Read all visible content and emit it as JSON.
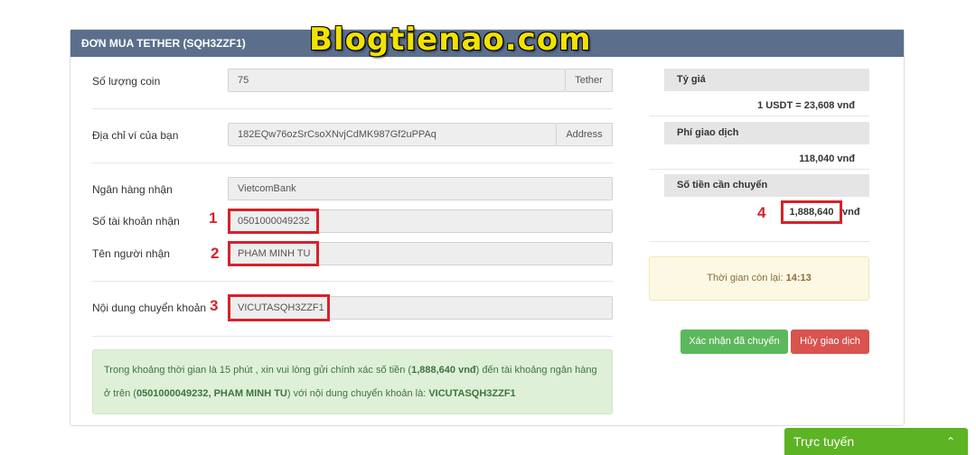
{
  "panel": {
    "title": "ĐƠN MUA TETHER (SQH3ZZF1)"
  },
  "watermark": "Blogtienao.com",
  "form": {
    "coin_label": "Số lượng coin",
    "coin_value": "75",
    "coin_unit": "Tether",
    "wallet_label": "Địa chỉ ví của bạn",
    "wallet_value": "182EQw76ozSrCsoXNvjCdMK987Gf2uPPAq",
    "wallet_unit": "Address",
    "bank_label": "Ngân hàng nhận",
    "bank_value": "VietcomBank",
    "account_label": "Số tài khoản nhận",
    "account_value": "0501000049232",
    "name_label": "Tên người nhận",
    "name_value": "PHAM MINH TU",
    "content_label": "Nội dung chuyển khoản",
    "content_value": "VICUTASQH3ZZF1"
  },
  "markers": {
    "m1": "1",
    "m2": "2",
    "m3": "3",
    "m4": "4"
  },
  "info": {
    "p1": "Trong khoảng thời gian là 15 phút , xin vui lòng gửi chính xác số tiền (",
    "amount": "1,888,640 vnđ",
    "p2": ") đến tài khoảng ngân hàng",
    "p3": "ở trên (",
    "account_name": "0501000049232, PHAM MINH TU",
    "p4": ") với nội dung chuyển khoản là: ",
    "content": "VICUTASQH3ZZF1"
  },
  "side": {
    "rate_label": "Tỷ giá",
    "rate_value": "1 USDT = 23,608 vnđ",
    "fee_label": "Phí giao dịch",
    "fee_value": "118,040 vnđ",
    "total_label": "Số tiền cần chuyển",
    "total_amount": "1,888,640",
    "total_unit": "vnđ",
    "timer_label": "Thời gian còn lại: ",
    "timer_value": "14:13",
    "confirm_button": "Xác nhận đã chuyển",
    "cancel_button": "Hủy giao dịch"
  },
  "chat": {
    "label": "Trực tuyến"
  },
  "colors": {
    "header": "#5b6f8d",
    "highlight": "#d5222b",
    "confirm": "#5cb85c",
    "cancel": "#d9534f",
    "chat": "#5cb323",
    "watermark": "#f2e200"
  }
}
